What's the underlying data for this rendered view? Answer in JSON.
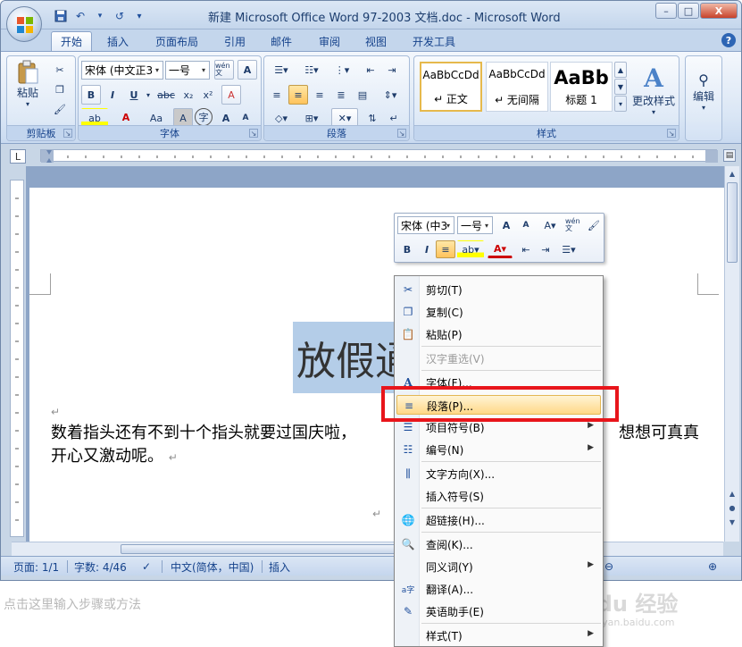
{
  "window": {
    "title": "新建 Microsoft Office Word 97-2003 文档.doc - Microsoft Word",
    "controls": {
      "minimize": "–",
      "maximize": "□",
      "close": "X"
    }
  },
  "quick_access": {
    "undo": "↶",
    "redo": "↷",
    "repeat": "↺",
    "customize": "▾"
  },
  "tabs": [
    "开始",
    "插入",
    "页面布局",
    "引用",
    "邮件",
    "审阅",
    "视图",
    "开发工具"
  ],
  "active_tab": "开始",
  "help": "?",
  "ribbon": {
    "clipboard": {
      "label": "剪贴板",
      "paste": "粘贴"
    },
    "font": {
      "label": "字体",
      "font_name": "宋体 (中文正3",
      "font_size": "一号",
      "phonetic": "wén 文",
      "border_char": "A",
      "bold": "B",
      "italic": "I",
      "underline": "U",
      "strike": "abc",
      "subscript": "x₂",
      "superscript": "x²",
      "clear": "A",
      "highlight": "ab",
      "font_color": "A",
      "change_case": "Aa",
      "shading": "A",
      "enclose": "字",
      "grow": "A",
      "shrink": "A"
    },
    "paragraph": {
      "label": "段落"
    },
    "styles": {
      "label": "样式",
      "items": [
        {
          "sample": "AaBbCcDd",
          "name": "↵ 正文"
        },
        {
          "sample": "AaBbCcDd",
          "name": "↵ 无间隔"
        },
        {
          "sample": "AaBb",
          "name": "标题 1"
        }
      ],
      "change_styles": "更改样式"
    },
    "editing": {
      "label": "编辑"
    }
  },
  "document": {
    "title": "放假通",
    "body_line1": "数着指头还有不到十个指头就要过国庆啦，",
    "body_line1_end": "想想可真真",
    "body_line2": "开心又激动呢。",
    "pilcrow": "↵"
  },
  "statusbar": {
    "page": "页面: 1/1",
    "words": "字数: 4/46",
    "language": "中文(简体，中国)",
    "mode": "插入"
  },
  "minibar": {
    "font_name": "宋体 (中3",
    "font_size": "一号",
    "bold": "B",
    "italic": "I",
    "grow": "A",
    "shrink": "A",
    "phonetic": "wén 文"
  },
  "context_menu": {
    "items": [
      {
        "id": "cut",
        "label": "剪切(T)",
        "icon": "✂"
      },
      {
        "id": "copy",
        "label": "复制(C)",
        "icon": "❐"
      },
      {
        "id": "paste",
        "label": "粘贴(P)",
        "icon": "📋"
      },
      {
        "id": "reconvert",
        "label": "汉字重选(V)",
        "icon": ""
      },
      {
        "id": "font",
        "label": "字体(F)...",
        "icon": "A"
      },
      {
        "id": "paragraph",
        "label": "段落(P)...",
        "icon": "≡"
      },
      {
        "id": "bullets",
        "label": "项目符号(B)",
        "icon": "☰"
      },
      {
        "id": "numbering",
        "label": "编号(N)",
        "icon": "☷"
      },
      {
        "id": "text-direction",
        "label": "文字方向(X)...",
        "icon": "⫼"
      },
      {
        "id": "insert-symbol",
        "label": "插入符号(S)",
        "icon": ""
      },
      {
        "id": "hyperlink",
        "label": "超链接(H)...",
        "icon": "🌐"
      },
      {
        "id": "lookup",
        "label": "查阅(K)...",
        "icon": "🔍"
      },
      {
        "id": "synonyms",
        "label": "同义词(Y)",
        "icon": ""
      },
      {
        "id": "translate",
        "label": "翻译(A)...",
        "icon": "a字"
      },
      {
        "id": "english-assistant",
        "label": "英语助手(E)",
        "icon": "✎"
      },
      {
        "id": "styles",
        "label": "样式(T)",
        "icon": ""
      }
    ],
    "submenu_arrow": "▶"
  },
  "caption": "点击这里输入步骤或方法",
  "watermark": "Baidu 经验",
  "watermark_sub": "jingyan.baidu.com",
  "colors": {
    "highlight_box": "#e8151b",
    "ribbon_blue": "#15428b",
    "selection": "#b4cde8"
  }
}
